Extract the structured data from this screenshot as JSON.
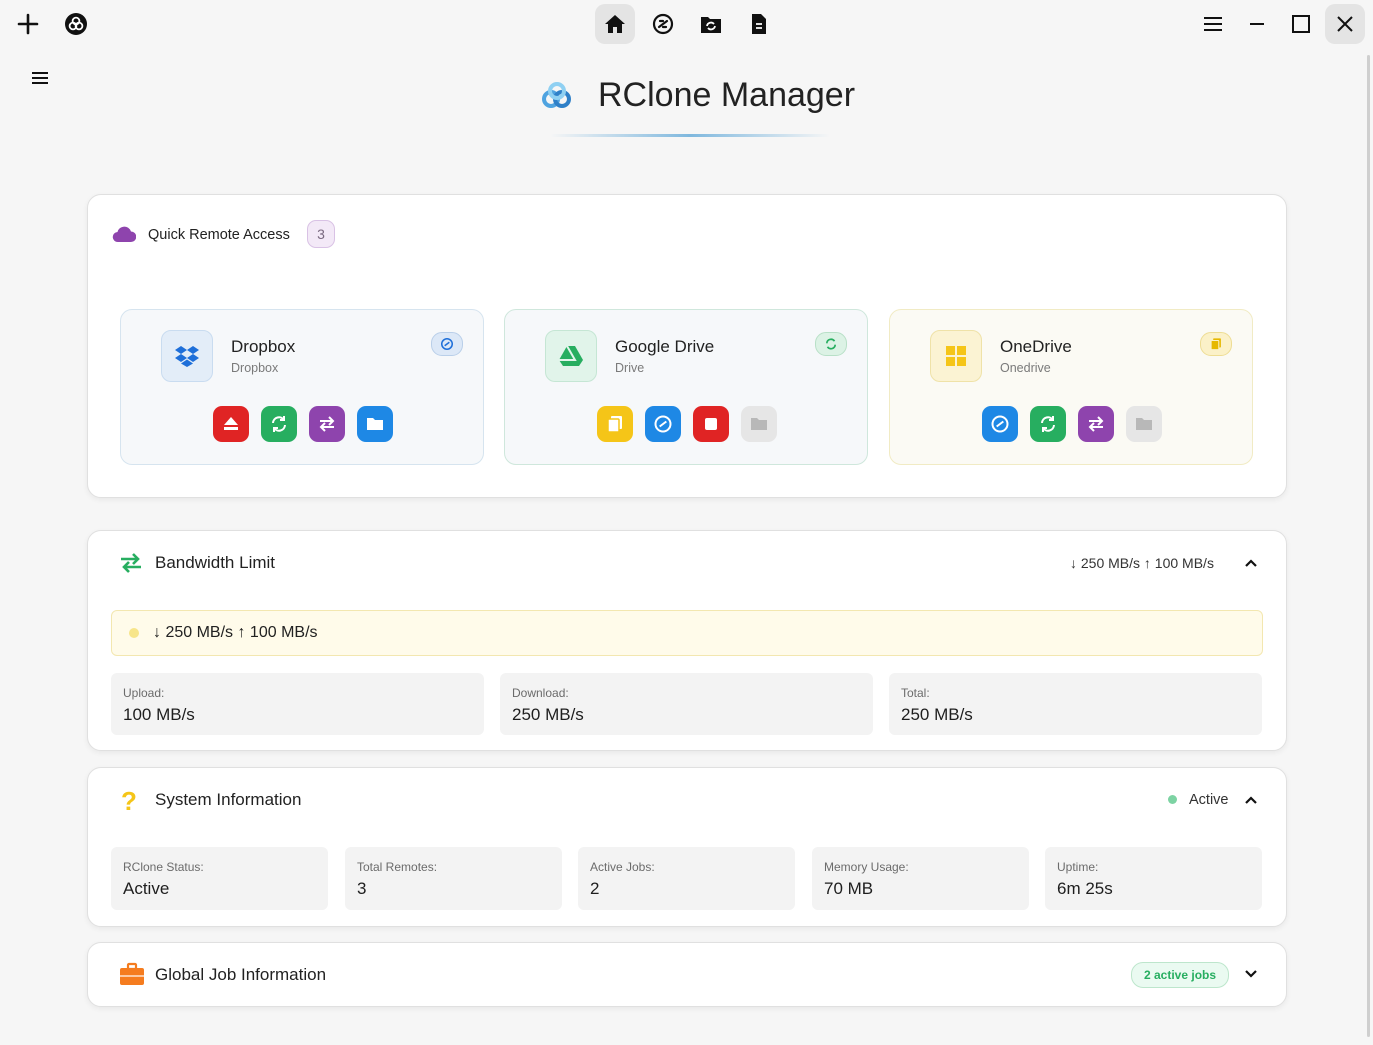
{
  "app": {
    "title": "RClone Manager"
  },
  "quick": {
    "title": "Quick Remote Access",
    "count": "3"
  },
  "remotes": [
    {
      "name": "Dropbox",
      "type": "Dropbox"
    },
    {
      "name": "Google Drive",
      "type": "Drive"
    },
    {
      "name": "OneDrive",
      "type": "Onedrive"
    }
  ],
  "bandwidth": {
    "title": "Bandwidth Limit",
    "summary": "↓ 250 MB/s ↑ 100 MB/s",
    "banner": "↓ 250 MB/s ↑ 100 MB/s",
    "stats": [
      {
        "label": "Upload:",
        "value": "100 MB/s"
      },
      {
        "label": "Download:",
        "value": "250 MB/s"
      },
      {
        "label": "Total:",
        "value": "250 MB/s"
      }
    ]
  },
  "system": {
    "title": "System Information",
    "status": "Active",
    "stats": [
      {
        "label": "RClone Status:",
        "value": "Active"
      },
      {
        "label": "Total Remotes:",
        "value": "3"
      },
      {
        "label": "Active Jobs:",
        "value": "2"
      },
      {
        "label": "Memory Usage:",
        "value": "70 MB"
      },
      {
        "label": "Uptime:",
        "value": "6m 25s"
      }
    ]
  },
  "jobs": {
    "title": "Global Job Information",
    "badge": "2 active jobs"
  },
  "colors": {
    "accent": "#4fa3e0",
    "purple": "#8e44ad",
    "green": "#27ae60",
    "red": "#e02424",
    "blue": "#1e88e5",
    "yellow": "#f5c518"
  }
}
